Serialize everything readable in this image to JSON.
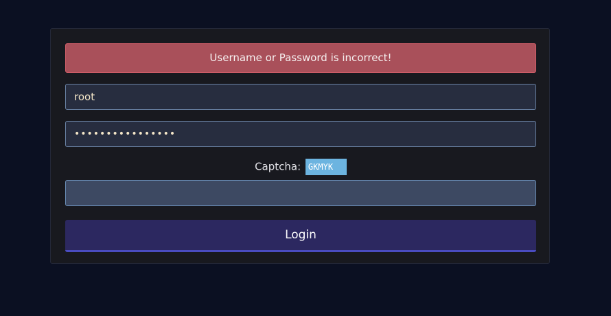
{
  "error": {
    "message": "Username or Password is incorrect!"
  },
  "form": {
    "username_value": "root",
    "password_value": "••••••••••••••••",
    "captcha_label": "Captcha:",
    "captcha_code": "GKMYK",
    "captcha_input_value": "",
    "login_label": "Login"
  },
  "colors": {
    "page_background": "#0b1022",
    "card_background": "#18191f",
    "error_background": "#a9505a",
    "input_background": "#272d3f",
    "captcha_code_background": "#6cb4e0",
    "login_button_background": "#2c2860",
    "login_button_accent": "#4a4cc0"
  }
}
